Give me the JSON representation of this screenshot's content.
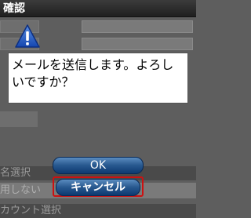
{
  "window": {
    "title": "確認"
  },
  "background": {
    "labels": [
      "名選択",
      "用しない",
      "カウント選択"
    ]
  },
  "dialog": {
    "message": "メールを送信します。よろしいですか？",
    "ok_label": "OK",
    "cancel_label": "キャンセル"
  }
}
